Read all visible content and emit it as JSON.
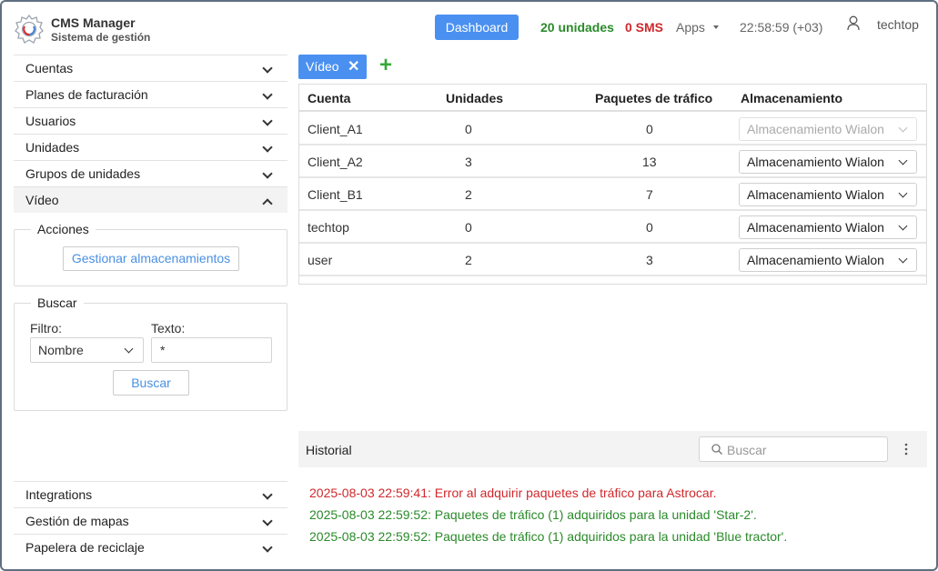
{
  "header": {
    "brand_title": "CMS Manager",
    "brand_subtitle": "Sistema de gestión",
    "dashboard_label": "Dashboard",
    "units": "20 unidades",
    "sms": "0 SMS",
    "apps_label": "Apps",
    "clock": "22:58:59 (+03)",
    "user": "techtop"
  },
  "sidebar": {
    "items": [
      {
        "label": "Cuentas"
      },
      {
        "label": "Planes de facturación"
      },
      {
        "label": "Usuarios"
      },
      {
        "label": "Unidades"
      },
      {
        "label": "Grupos de unidades"
      },
      {
        "label": "Vídeo"
      }
    ],
    "actions_legend": "Acciones",
    "manage_button": "Gestionar almacenamientos",
    "search_legend": "Buscar",
    "filter_label": "Filtro:",
    "filter_value": "Nombre",
    "text_label": "Texto:",
    "text_value": "*",
    "search_button": "Buscar",
    "bottom_items": [
      {
        "label": "Integrations"
      },
      {
        "label": "Gestión de mapas"
      },
      {
        "label": "Papelera de reciclaje"
      }
    ]
  },
  "tabs": [
    {
      "label": "Vídeo"
    }
  ],
  "table": {
    "columns": [
      "Cuenta",
      "Unidades",
      "Paquetes de tráfico",
      "Almacenamiento"
    ],
    "rows": [
      {
        "account": "Client_A1",
        "units": "0",
        "packages": "0",
        "storage": "Almacenamiento Wialon"
      },
      {
        "account": "Client_A2",
        "units": "3",
        "packages": "13",
        "storage": "Almacenamiento Wialon"
      },
      {
        "account": "Client_B1",
        "units": "2",
        "packages": "7",
        "storage": "Almacenamiento Wialon"
      },
      {
        "account": "techtop",
        "units": "0",
        "packages": "0",
        "storage": "Almacenamiento Wialon"
      },
      {
        "account": "user",
        "units": "2",
        "packages": "3",
        "storage": "Almacenamiento Wialon"
      }
    ]
  },
  "history": {
    "title": "Historial",
    "search_placeholder": "Buscar",
    "logs": [
      {
        "text": "2025-08-03 22:59:41: Error al adquirir paquetes de tráfico para Astrocar."
      },
      {
        "text": "2025-08-03 22:59:52: Paquetes de tráfico (1) adquiridos para la unidad 'Star-2'."
      },
      {
        "text": "2025-08-03 22:59:52: Paquetes de tráfico (1) adquiridos para la unidad 'Blue tractor'."
      }
    ]
  },
  "colors": {
    "accent": "#4a90f0",
    "success": "#2a8a2a",
    "error": "#d0282c"
  }
}
